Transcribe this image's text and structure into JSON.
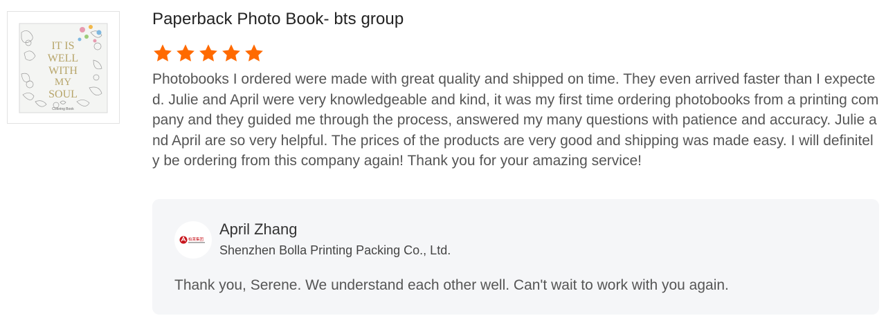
{
  "review": {
    "product_image_alt": "Coloring book cover",
    "cover_text": {
      "title_lines": [
        "IT IS",
        "WELL",
        "WITH",
        "MY",
        "SOUL"
      ],
      "subtitle": "Coloring Book"
    },
    "product_title": "Paperback Photo Book- bts group",
    "rating": 5,
    "text": "Photobooks I ordered were made with great quality and shipped on time. They even arrived faster than I expected. Julie and April were very knowledgeable and kind, it was my first time ordering photobooks from a printing company and they guided me through the process, answered my many questions with patience and accuracy. Julie and April are so very helpful. The prices of the products are very good and shipping was made easy. I will definitely be ordering from this company again! Thank you for your amazing service!"
  },
  "reply": {
    "name": "April Zhang",
    "company": "Shenzhen Bolla Printing Packing Co., Ltd.",
    "logo_text": "柏莱集团",
    "text": "Thank you, Serene. We understand each other well. Can't wait to work with you again."
  },
  "colors": {
    "star": "#ff6a00",
    "reply_bg": "#f5f6f8",
    "logo_red": "#c8161d"
  },
  "icons": {
    "star": "star-icon",
    "logo": "company-logo"
  }
}
